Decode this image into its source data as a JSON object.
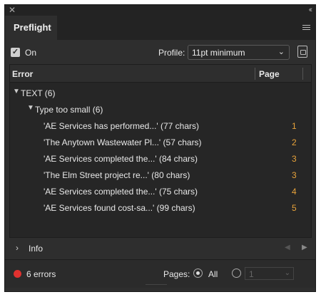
{
  "panel": {
    "tab_title": "Preflight",
    "on_label": "On",
    "on_checked": true,
    "profile_label": "Profile:",
    "profile_value": "11pt minimum"
  },
  "table": {
    "col_error": "Error",
    "col_page": "Page",
    "group": "TEXT (6)",
    "subgroup": "Type too small (6)",
    "rows": [
      {
        "text": "'AE Services has performed...' (77 chars)",
        "page": "1"
      },
      {
        "text": "'The Anytown Wastewater Pl...' (57 chars)",
        "page": "2"
      },
      {
        "text": "'AE Services completed the...' (84 chars)",
        "page": "3"
      },
      {
        "text": "'The Elm Street project re...' (80 chars)",
        "page": "3"
      },
      {
        "text": "'AE Services completed the...' (75 chars)",
        "page": "4"
      },
      {
        "text": "'AE Services found cost-sa...' (99 chars)",
        "page": "5"
      }
    ]
  },
  "info_label": "Info",
  "status": {
    "errors_text": "6 errors",
    "pages_label": "Pages:",
    "all_label": "All",
    "range_value": "1"
  },
  "colors": {
    "error_dot": "#e0312f",
    "page_number": "#e8a33a"
  }
}
